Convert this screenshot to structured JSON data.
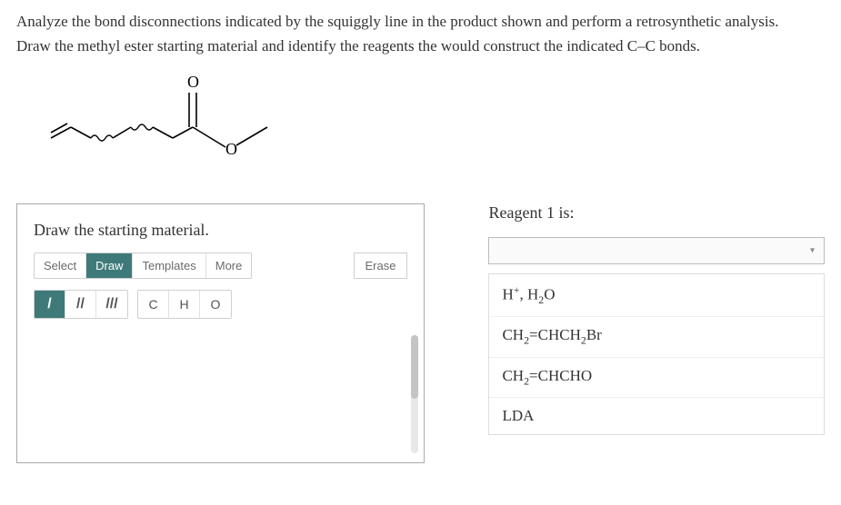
{
  "question": {
    "line1": "Analyze the bond disconnections indicated by the squiggly line in the product shown and perform a retrosynthetic analysis.",
    "line2": "Draw the methyl ester starting material and identify the reagents the would construct the indicated C–C bonds."
  },
  "molecule": {
    "description": "Methyl ester product with two squiggly bond disconnections on carbon chain, terminal alkene, carbonyl group",
    "atom_label_O_top": "O",
    "atom_label_O_chain": "O"
  },
  "left_panel": {
    "title": "Draw the starting material.",
    "tabs": {
      "select": "Select",
      "draw": "Draw",
      "templates": "Templates",
      "more": "More"
    },
    "erase": "Erase",
    "bond_tools": {
      "single": "/",
      "double": "//",
      "triple": "///"
    },
    "atom_tools": {
      "c": "C",
      "h": "H",
      "o": "O"
    }
  },
  "right_panel": {
    "title": "Reagent 1 is:",
    "dropdown_value": "",
    "options": [
      {
        "html": "H<sup>+</sup>, H<sub>2</sub>O",
        "plain": "H+, H2O"
      },
      {
        "html": "CH<sub>2</sub>=CHCH<sub>2</sub>Br",
        "plain": "CH2=CHCH2Br"
      },
      {
        "html": "CH<sub>2</sub>=CHCHO",
        "plain": "CH2=CHCHO"
      },
      {
        "html": "LDA",
        "plain": "LDA"
      }
    ]
  }
}
